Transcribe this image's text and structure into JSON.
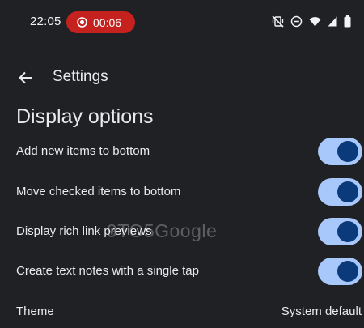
{
  "status_bar": {
    "time": "22:05",
    "recording_time": "00:06",
    "icons": [
      "vibrate-off-icon",
      "do-not-disturb-icon",
      "wifi-icon",
      "signal-icon",
      "battery-icon"
    ],
    "recording_color": "#c5221f"
  },
  "app_bar": {
    "back_icon": "arrow-left-icon",
    "title": "Settings"
  },
  "section": {
    "title": "Display options"
  },
  "settings": [
    {
      "label": "Add new items to bottom",
      "enabled": true
    },
    {
      "label": "Move checked items to bottom",
      "enabled": true
    },
    {
      "label": "Display rich link previews",
      "enabled": true
    },
    {
      "label": "Create text notes with a single tap",
      "enabled": true
    }
  ],
  "theme": {
    "label": "Theme",
    "value": "System default"
  },
  "watermark": "9TO5Google",
  "colors": {
    "background": "#202124",
    "toggle_track": "#a8c7fa",
    "toggle_thumb": "#0b3a7a",
    "text": "#e8eaed"
  }
}
